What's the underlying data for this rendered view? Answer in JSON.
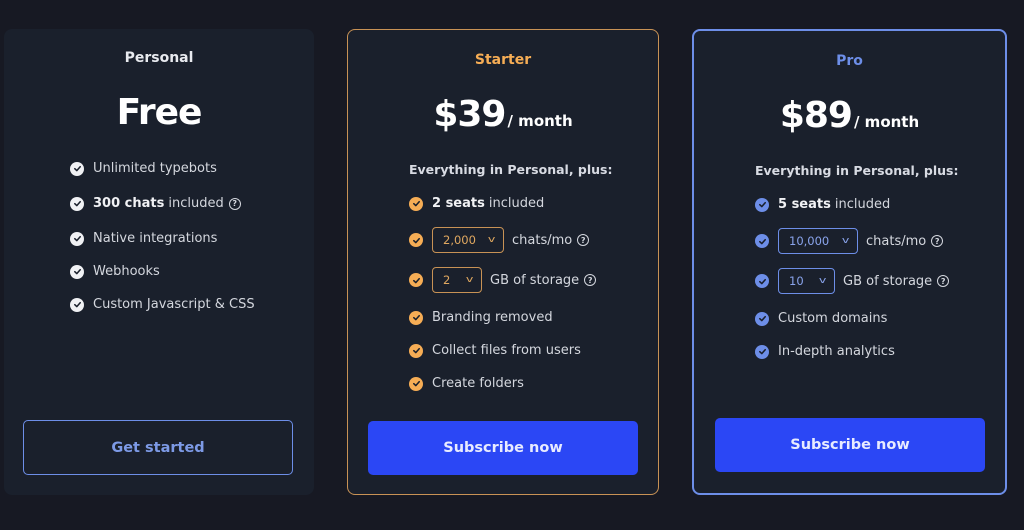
{
  "colors": {
    "background": "#171923",
    "card": "#1a202c",
    "starter_accent": "#f6ad55",
    "pro_accent": "#6d8ee8",
    "button_primary": "#2b47f5",
    "personal_check": "#ffffff"
  },
  "plans": [
    {
      "name": "Personal",
      "price": "Free",
      "period": "",
      "features": [
        {
          "bold": "",
          "text": "Unlimited typebots",
          "help": false
        },
        {
          "bold": "300 chats",
          "text": "included",
          "help": true
        },
        {
          "bold": "",
          "text": "Native integrations",
          "help": false
        },
        {
          "bold": "",
          "text": "Webhooks",
          "help": false
        },
        {
          "bold": "",
          "text": "Custom Javascript & CSS",
          "help": false
        }
      ],
      "cta": "Get started"
    },
    {
      "name": "Starter",
      "price": "$39",
      "period": "/ month",
      "subhead": "Everything in Personal, plus:",
      "features": [
        {
          "bold": "2 seats",
          "text": "included",
          "help": false
        },
        {
          "select": "2,000",
          "text": "chats/mo",
          "help": true
        },
        {
          "select": "2",
          "text": "GB of storage",
          "help": true
        },
        {
          "bold": "",
          "text": "Branding removed",
          "help": false
        },
        {
          "bold": "",
          "text": "Collect files from users",
          "help": false
        },
        {
          "bold": "",
          "text": "Create folders",
          "help": false
        }
      ],
      "cta": "Subscribe now"
    },
    {
      "name": "Pro",
      "price": "$89",
      "period": "/ month",
      "subhead": "Everything in Personal, plus:",
      "features": [
        {
          "bold": "5 seats",
          "text": "included",
          "help": false
        },
        {
          "select": "10,000",
          "text": "chats/mo",
          "help": true
        },
        {
          "select": "10",
          "text": "GB of storage",
          "help": true
        },
        {
          "bold": "",
          "text": "Custom domains",
          "help": false
        },
        {
          "bold": "",
          "text": "In-depth analytics",
          "help": false
        }
      ],
      "cta": "Subscribe now"
    }
  ],
  "icons": {
    "check": "check-circle-icon",
    "help": "question-circle-icon",
    "chevron": "chevron-down-icon"
  },
  "glyphs": {
    "help": "?",
    "chevron": "v"
  }
}
